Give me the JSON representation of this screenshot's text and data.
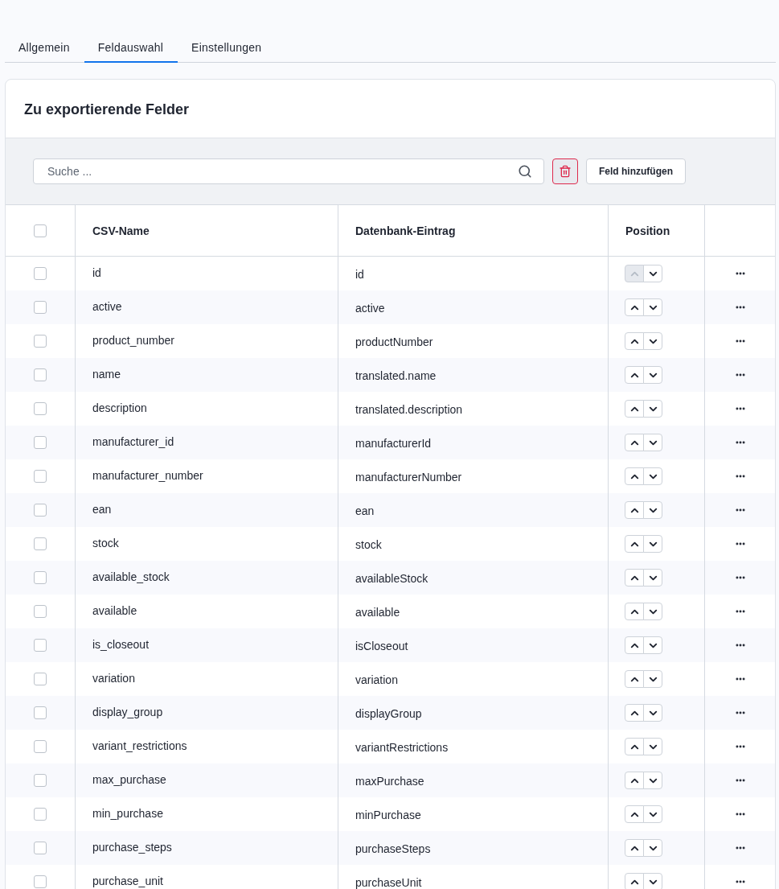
{
  "tabs": [
    {
      "label": "Allgemein",
      "selected": false
    },
    {
      "label": "Feldauswahl",
      "selected": true
    },
    {
      "label": "Einstellungen",
      "selected": false
    }
  ],
  "card": {
    "title": "Zu exportierende Felder",
    "search": {
      "placeholder": "Suche ..."
    },
    "add_button": "Feld hinzufügen",
    "table": {
      "all_checked": false,
      "columns": [
        "CSV-Name",
        "Datenbank-Eintrag",
        "Position"
      ],
      "rows": [
        {
          "csv_name": "id",
          "db_entry": "id",
          "checked": false,
          "up_disabled": true
        },
        {
          "csv_name": "active",
          "db_entry": "active",
          "checked": false,
          "up_disabled": false
        },
        {
          "csv_name": "product_number",
          "db_entry": "productNumber",
          "checked": false,
          "up_disabled": false
        },
        {
          "csv_name": "name",
          "db_entry": "translated.name",
          "checked": false,
          "up_disabled": false
        },
        {
          "csv_name": "description",
          "db_entry": "translated.description",
          "checked": false,
          "up_disabled": false
        },
        {
          "csv_name": "manufacturer_id",
          "db_entry": "manufacturerId",
          "checked": false,
          "up_disabled": false
        },
        {
          "csv_name": "manufacturer_number",
          "db_entry": "manufacturerNumber",
          "checked": false,
          "up_disabled": false
        },
        {
          "csv_name": "ean",
          "db_entry": "ean",
          "checked": false,
          "up_disabled": false
        },
        {
          "csv_name": "stock",
          "db_entry": "stock",
          "checked": false,
          "up_disabled": false
        },
        {
          "csv_name": "available_stock",
          "db_entry": "availableStock",
          "checked": false,
          "up_disabled": false
        },
        {
          "csv_name": "available",
          "db_entry": "available",
          "checked": false,
          "up_disabled": false
        },
        {
          "csv_name": "is_closeout",
          "db_entry": "isCloseout",
          "checked": false,
          "up_disabled": false
        },
        {
          "csv_name": "variation",
          "db_entry": "variation",
          "checked": false,
          "up_disabled": false
        },
        {
          "csv_name": "display_group",
          "db_entry": "displayGroup",
          "checked": false,
          "up_disabled": false
        },
        {
          "csv_name": "variant_restrictions",
          "db_entry": "variantRestrictions",
          "checked": false,
          "up_disabled": false
        },
        {
          "csv_name": "max_purchase",
          "db_entry": "maxPurchase",
          "checked": false,
          "up_disabled": false
        },
        {
          "csv_name": "min_purchase",
          "db_entry": "minPurchase",
          "checked": false,
          "up_disabled": false
        },
        {
          "csv_name": "purchase_steps",
          "db_entry": "purchaseSteps",
          "checked": false,
          "up_disabled": false
        },
        {
          "csv_name": "purchase_unit",
          "db_entry": "purchaseUnit",
          "checked": false,
          "up_disabled": false
        }
      ]
    }
  }
}
